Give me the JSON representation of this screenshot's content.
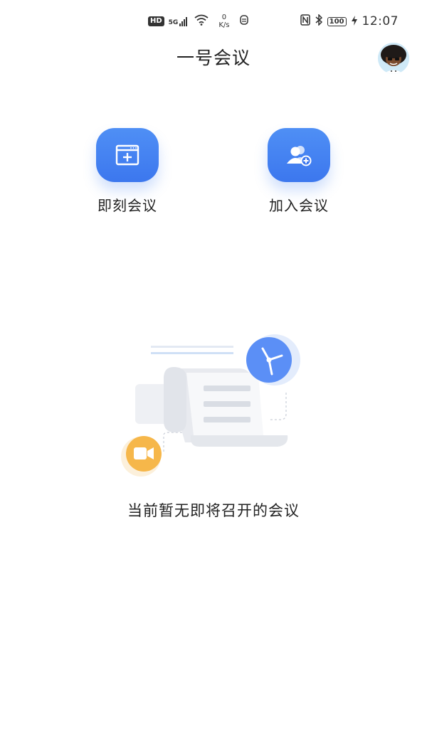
{
  "status_bar": {
    "hd_badge": "HD",
    "net_type": "5G",
    "net_speed_value": "0",
    "net_speed_unit": "K/s",
    "battery": "100",
    "time": "12:07",
    "icons": [
      "signal-icon",
      "wifi-icon",
      "sync-icon",
      "nfc-icon",
      "bluetooth-icon",
      "battery-icon",
      "charging-icon"
    ]
  },
  "header": {
    "title": "一号会议",
    "avatar_icon": "user-avatar"
  },
  "actions": {
    "instant_meeting_label": "即刻会议",
    "instant_meeting_icon": "new-meeting-icon",
    "join_meeting_label": "加入会议",
    "join_meeting_icon": "join-meeting-icon",
    "accent_color": "#4a86f2"
  },
  "empty_state": {
    "message": "当前暂无即将召开的会议",
    "illustration_icons": [
      "document-icon",
      "clock-icon",
      "video-camera-icon"
    ],
    "clock_color": "#5b8ff6",
    "camera_color": "#f6b74a"
  }
}
